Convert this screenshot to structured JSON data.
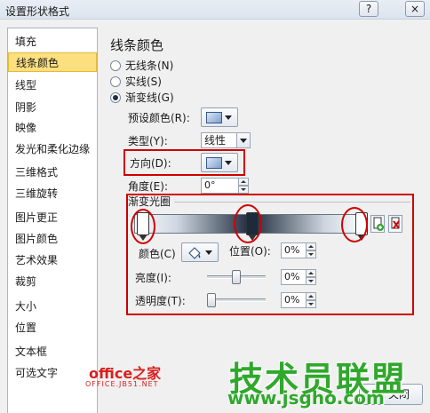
{
  "window": {
    "title": "设置形状格式",
    "help_glyph": "?",
    "close_glyph": "×"
  },
  "nav": {
    "selected_index": 1,
    "items": [
      "填充",
      "线条颜色",
      "线型",
      "阴影",
      "映像",
      "发光和柔化边缘",
      "三维格式",
      "三维旋转",
      "图片更正",
      "图片颜色",
      "艺术效果",
      "裁剪",
      "大小",
      "位置",
      "文本框",
      "可选文字"
    ]
  },
  "panel": {
    "title": "线条颜色",
    "radios": [
      {
        "label": "无线条(N)",
        "checked": false
      },
      {
        "label": "实线(S)",
        "checked": false
      },
      {
        "label": "渐变线(G)",
        "checked": true
      }
    ],
    "preset_label": "预设颜色(R):",
    "type_label": "类型(Y):",
    "type_value": "线性",
    "direction_label": "方向(D):",
    "angle_label": "角度(E):",
    "angle_value": "0°",
    "stops_group_label": "渐变光圈",
    "color_label": "颜色(C)",
    "position_label": "位置(O):",
    "position_value": "0%",
    "brightness_label": "亮度(I):",
    "brightness_value": "0%",
    "brightness_level": 0.5,
    "transparency_label": "透明度(T):",
    "transparency_value": "0%",
    "transparency_level": 0.0,
    "close_button": "关闭"
  },
  "gradient": {
    "stops": [
      0.0,
      0.5,
      1.0
    ],
    "colors": [
      "#ffffff",
      "#1d2a3c",
      "#ffffff"
    ]
  },
  "watermarks": {
    "office_logo": "office之家",
    "office_url": "OFFICE.JB51.NET",
    "site_logo": "技术员联盟",
    "site_url": "www.jsgho.com"
  },
  "icons": {
    "preset_swatch": "gradient-swatch-icon",
    "direction_swatch": "gradient-swatch-icon",
    "fill_bucket": "paint-bucket-icon",
    "add_stop": "add-stop-icon",
    "remove_stop": "remove-stop-icon"
  },
  "colors": {
    "highlight": "#d00000",
    "selected_nav": "#fce07f",
    "watermark_green": "#2fa82b",
    "watermark_red": "#d8201e"
  }
}
